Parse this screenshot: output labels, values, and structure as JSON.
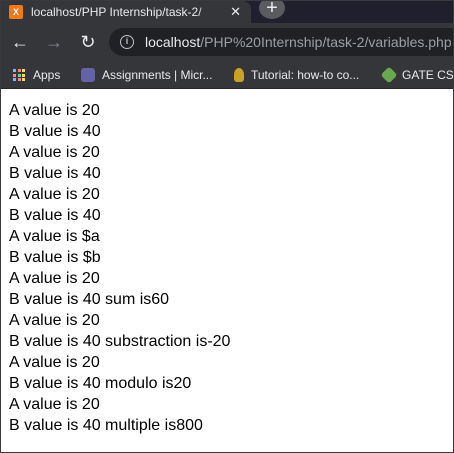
{
  "tab": {
    "title": "localhost/PHP Internship/task-2/",
    "favicon_letter": "X",
    "close_glyph": "✕"
  },
  "new_tab_glyph": "+",
  "nav": {
    "back_glyph": "←",
    "forward_glyph": "→",
    "reload_glyph": "↻"
  },
  "address_bar": {
    "host": "localhost",
    "path": "/PHP%20Internship/task-2/variables.php",
    "info_glyph": "i"
  },
  "bookmarks": [
    {
      "label": "Apps",
      "icon": "apps-grid-icon"
    },
    {
      "label": "Assignments | Micr...",
      "icon": "teams-icon"
    },
    {
      "label": "Tutorial: how-to co...",
      "icon": "tutorial-icon"
    },
    {
      "label": "GATE CSE",
      "icon": "gate-icon"
    }
  ],
  "output_lines": [
    "A value is 20",
    "B value is 40",
    "A value is 20",
    "B value is 40",
    "A value is 20",
    "B value is 40",
    "A value is $a",
    "B value is $b",
    "A value is 20",
    "B value is 40 sum is60",
    "A value is 20",
    "B value is 40 substraction is-20",
    "A value is 20",
    "B value is 40 modulo is20",
    "A value is 20",
    "B value is 40 multiple is800"
  ]
}
